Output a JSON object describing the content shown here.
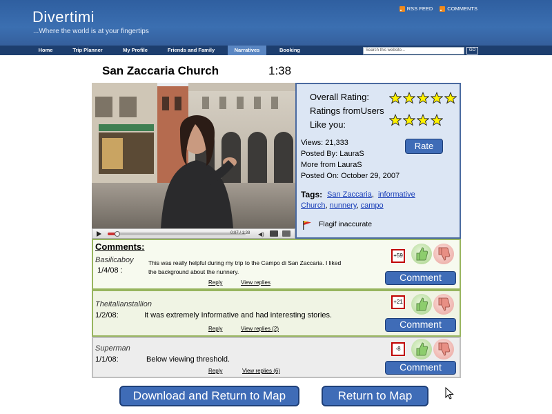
{
  "site": {
    "logo": "Divertimi",
    "tagline": "...Where the world is at your fingertips",
    "rss_label": "RSS FEED",
    "comments_label": "COMMENTS"
  },
  "nav": {
    "tabs": [
      {
        "label": "Home"
      },
      {
        "label": "Trip Planner"
      },
      {
        "label": "My Profile"
      },
      {
        "label": "Friends and Family"
      },
      {
        "label": "Narratives",
        "active": true
      },
      {
        "label": "Booking"
      }
    ],
    "search_placeholder": "Search this website...",
    "go_label": "GO"
  },
  "video": {
    "title": "San Zaccaria Church",
    "duration": "1:38",
    "time_readout": "0:07 / 1:38",
    "progress_fraction": 0.07
  },
  "info": {
    "overall_rating_label": "Overall Rating:",
    "overall_rating_stars": 5,
    "users_rating_label_1": "Ratings fromUsers",
    "users_rating_label_2": "Like you:",
    "users_rating_stars": 4,
    "views": "Views: 21,333",
    "posted_by": "Posted By: LauraS",
    "more_from": "More from LauraS",
    "posted_on": "Posted On: October 29, 2007",
    "rate_label": "Rate",
    "tags_label": "Tags:",
    "tags": [
      "San Zaccaria",
      "informative",
      "Church",
      "nunnery",
      "campo"
    ],
    "flag_label": "Flagif inaccurate"
  },
  "comments": {
    "heading": "Comments:",
    "items": [
      {
        "user": "Basilicaboy",
        "date": "1/4/08 :",
        "text_line1": "This was really helpful during my trip to the Campo  di San Zaccaria. I liked",
        "text_line2": "the background about the nunnery.",
        "reply": "Reply",
        "view_replies": "View replies",
        "score": "+59",
        "button": "Comment"
      },
      {
        "user": "Theitalianstallion",
        "date": "1/2/08:",
        "text_line1": "It was extremely Informative and had interesting stories.",
        "reply": "Reply",
        "view_replies": "View replies (2)",
        "score": "+21",
        "button": "Comment"
      },
      {
        "user": "Superman",
        "date": "1/1/08:",
        "text_line1": "Below viewing threshold.",
        "reply": "Reply",
        "view_replies": "View replies (6)",
        "score": "-8",
        "button": "Comment"
      }
    ]
  },
  "actions": {
    "download_label": "Download and Return to Map",
    "return_label": "Return to Map"
  },
  "colors": {
    "header_blue": "#3b6fb1",
    "button_blue": "#3f6cb7",
    "panel_blue": "#dce6f4",
    "comment_green_border": "#98b55f",
    "score_red": "#c00000"
  }
}
